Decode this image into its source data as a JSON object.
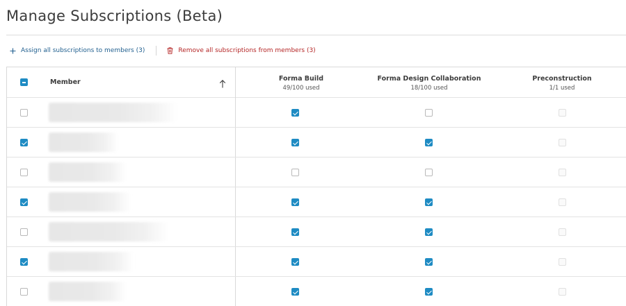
{
  "page": {
    "title": "Manage Subscriptions (Beta)"
  },
  "actions": {
    "assign_label": "Assign all subscriptions to members (3)",
    "remove_label": "Remove all subscriptions from members (3)"
  },
  "table": {
    "member_header": "Member",
    "select_all_state": "mixed",
    "sort": "ascending",
    "columns": [
      {
        "name": "Forma Build",
        "usage": "49/100 used"
      },
      {
        "name": "Forma Design Collaboration",
        "usage": "18/100 used"
      },
      {
        "name": "Preconstruction",
        "usage": "1/1 used"
      }
    ],
    "rows": [
      {
        "selected": false,
        "subs": [
          true,
          false,
          false
        ]
      },
      {
        "selected": true,
        "subs": [
          true,
          true,
          false
        ]
      },
      {
        "selected": false,
        "subs": [
          false,
          false,
          false
        ]
      },
      {
        "selected": true,
        "subs": [
          true,
          true,
          false
        ]
      },
      {
        "selected": false,
        "subs": [
          true,
          true,
          false
        ]
      },
      {
        "selected": true,
        "subs": [
          true,
          true,
          false
        ]
      },
      {
        "selected": false,
        "subs": [
          true,
          true,
          false
        ]
      }
    ],
    "preconstruction_disabled": true
  },
  "colors": {
    "accent": "#1e8bc3",
    "link": "#1f5e8e",
    "danger": "#b42525"
  }
}
